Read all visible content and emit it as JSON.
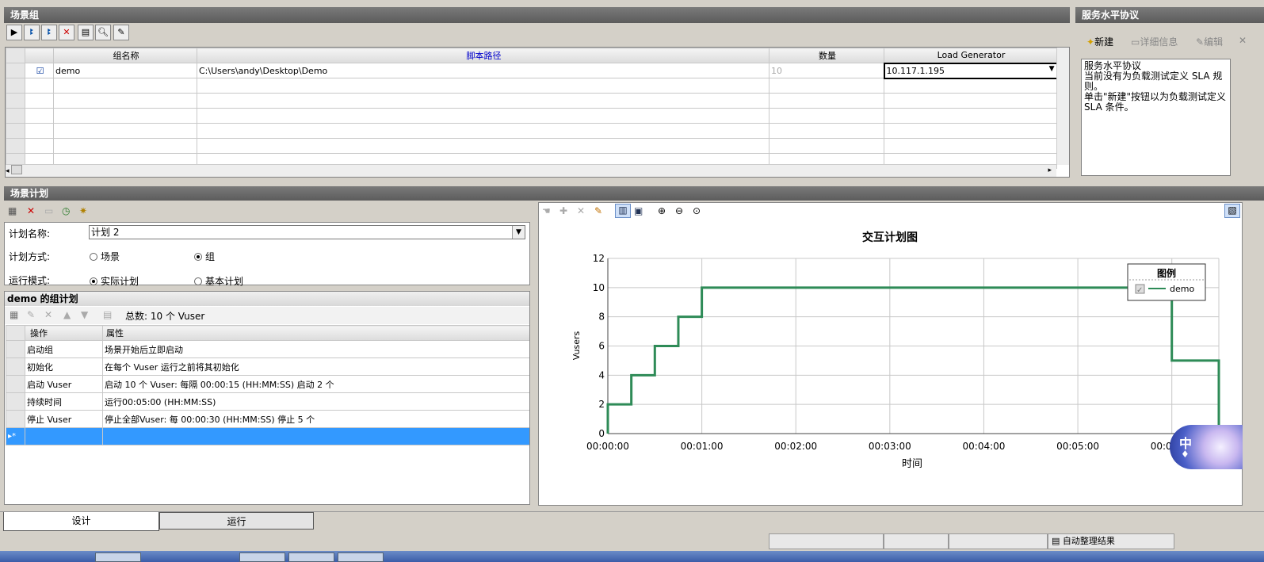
{
  "scenario_group": {
    "title": "场景组",
    "columns": [
      "组名称",
      "脚本路径",
      "数量",
      "Load Generator"
    ],
    "rows": [
      {
        "name": "demo",
        "path": "C:\\Users\\andy\\Desktop\\Demo",
        "qty": "10",
        "lg": "10.117.1.195"
      }
    ]
  },
  "sla": {
    "title": "服务水平协议",
    "new_label": "新建",
    "detail_label": "详细信息",
    "edit_label": "编辑",
    "text_heading": "服务水平协议",
    "text_line1": "当前没有为负载测试定义 SLA 规则。",
    "text_line2": "单击\"新建\"按钮以为负载测试定义 SLA 条件。"
  },
  "schedule": {
    "title": "场景计划",
    "name_label": "计划名称:",
    "name_value": "计划 2",
    "mode_label": "计划方式:",
    "mode_scene": "场景",
    "mode_group": "组",
    "run_label": "运行模式:",
    "run_actual": "实际计划",
    "run_basic": "基本计划"
  },
  "group_plan": {
    "title": "demo 的组计划",
    "total": "总数: 10 个 Vuser",
    "columns": [
      "操作",
      "属性"
    ],
    "rows": [
      {
        "op": "启动组",
        "attr": "场景开始后立即启动"
      },
      {
        "op": "初始化",
        "attr": "在每个 Vuser 运行之前将其初始化"
      },
      {
        "op": "启动 Vuser",
        "attr": "启动 10 个 Vuser: 每隔 00:00:15 (HH:MM:SS) 启动 2 个"
      },
      {
        "op": "持续时间",
        "attr": "运行00:05:00 (HH:MM:SS)"
      },
      {
        "op": "停止 Vuser",
        "attr": "停止全部Vuser: 每 00:00:30 (HH:MM:SS) 停止 5 个"
      }
    ],
    "new_row_marker": "▸*"
  },
  "tabs": {
    "design": "设计",
    "run": "运行"
  },
  "status": {
    "auto_collate": "自动整理结果"
  },
  "ime": {
    "text": "中"
  },
  "chart_data": {
    "type": "line",
    "title": "交互计划图",
    "xlabel": "时间",
    "ylabel": "Vusers",
    "xlim": [
      0,
      390
    ],
    "ylim": [
      0,
      12
    ],
    "yticks": [
      0,
      2,
      4,
      6,
      8,
      10,
      12
    ],
    "xticks_seconds": [
      0,
      60,
      120,
      180,
      240,
      300,
      360
    ],
    "xtick_labels": [
      "00:00:00",
      "00:01:00",
      "00:02:00",
      "00:03:00",
      "00:04:00",
      "00:05:00",
      "00:06:00"
    ],
    "legend_title": "图例",
    "legend_position": "top-right",
    "series": [
      {
        "name": "demo",
        "color": "#2e8b57",
        "points": [
          [
            0,
            0
          ],
          [
            0,
            2
          ],
          [
            15,
            2
          ],
          [
            15,
            4
          ],
          [
            30,
            4
          ],
          [
            30,
            6
          ],
          [
            45,
            6
          ],
          [
            45,
            8
          ],
          [
            60,
            8
          ],
          [
            60,
            10
          ],
          [
            360,
            10
          ],
          [
            360,
            5
          ],
          [
            390,
            5
          ],
          [
            390,
            0
          ]
        ]
      }
    ]
  }
}
